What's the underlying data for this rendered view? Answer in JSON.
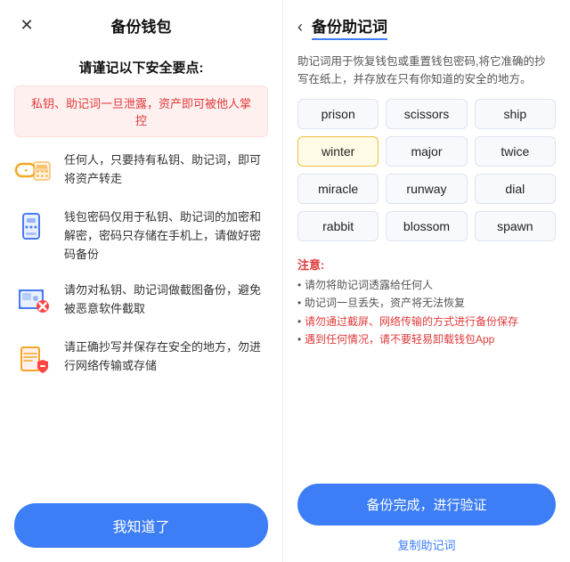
{
  "left": {
    "close_icon": "✕",
    "title": "备份钱包",
    "subtitle": "请谨记以下安全要点:",
    "warning": "私钥、助记词一旦泄露，资产即可被他人掌控",
    "items": [
      {
        "icon": "🔑",
        "text": "任何人，只要持有私钥、助记词，即可将资产转走"
      },
      {
        "icon": "📱",
        "text": "钱包密码仅用于私钥、助记词的加密和解密，密码只存储在手机上，请做好密码备份"
      },
      {
        "icon": "📷",
        "text": "请勿对私钥、助记词做截图备份，避免被恶意软件截取"
      },
      {
        "icon": "📋",
        "text": "请正确抄写并保存在安全的地方，勿进行网络传输或存储"
      }
    ],
    "bottom_button": "我知道了"
  },
  "right": {
    "back_icon": "‹",
    "title": "备份助记词",
    "description": "助记词用于恢复钱包或重置钱包密码,将它准确的抄写在纸上，并存放在只有你知道的安全的地方。",
    "words": [
      "prison",
      "scissors",
      "ship",
      "winter",
      "major",
      "twice",
      "miracle",
      "runway",
      "dial",
      "rabbit",
      "blossom",
      "spawn"
    ],
    "highlighted_word": "winter",
    "notes_title": "注意:",
    "notes": [
      {
        "text": "请勿将助记词透露给任何人",
        "red": false
      },
      {
        "text": "助记词一旦丢失，资产将无法恢复",
        "red": false
      },
      {
        "text": "请勿通过截屏、网络传输的方式进行备份保存",
        "red": true
      },
      {
        "text": "遇到任何情况，请不要轻易卸载钱包App",
        "red": true
      }
    ],
    "verify_button": "备份完成，进行验证",
    "copy_button": "复制助记词"
  }
}
